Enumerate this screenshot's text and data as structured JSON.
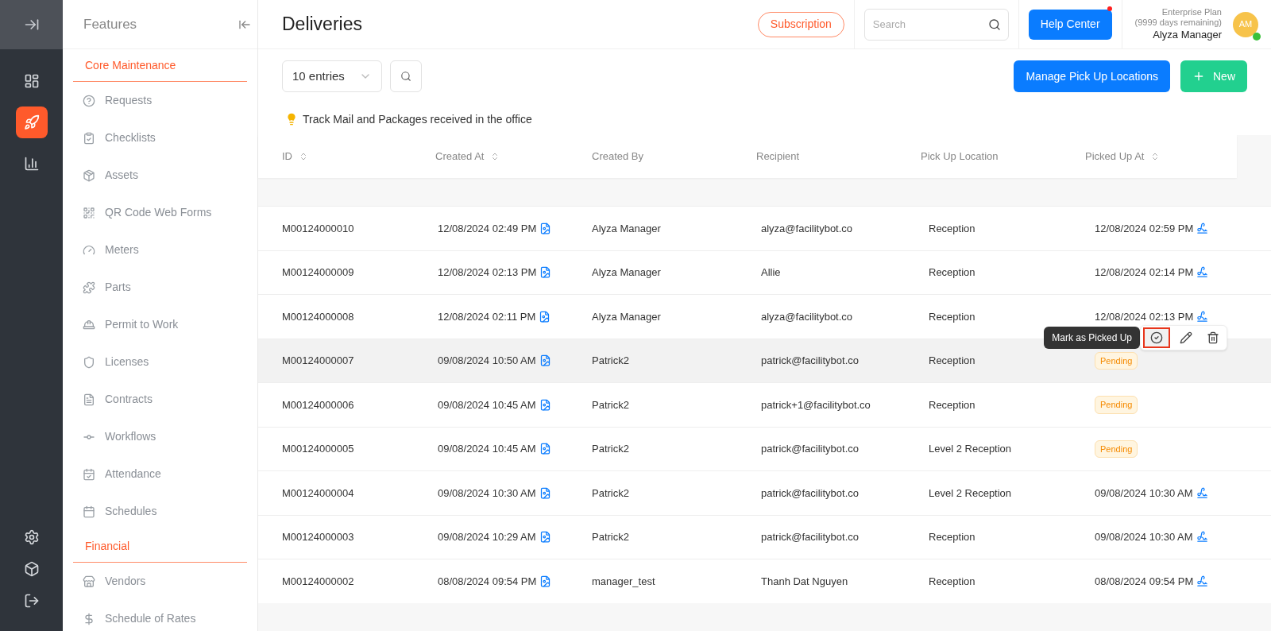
{
  "rail": {
    "items": [
      {
        "selected": false
      },
      {
        "selected": true
      },
      {
        "selected": false
      }
    ]
  },
  "features": {
    "title": "Features",
    "sections": [
      {
        "title": "Core Maintenance",
        "items": [
          {
            "label": "Requests"
          },
          {
            "label": "Checklists"
          },
          {
            "label": "Assets"
          },
          {
            "label": "QR Code Web Forms"
          },
          {
            "label": "Meters"
          },
          {
            "label": "Parts"
          },
          {
            "label": "Permit to Work"
          },
          {
            "label": "Licenses"
          },
          {
            "label": "Contracts"
          },
          {
            "label": "Workflows"
          },
          {
            "label": "Attendance"
          },
          {
            "label": "Schedules"
          }
        ]
      },
      {
        "title": "Financial",
        "items": [
          {
            "label": "Vendors"
          },
          {
            "label": "Schedule of Rates"
          }
        ]
      }
    ]
  },
  "header": {
    "title": "Deliveries",
    "subscription": "Subscription",
    "search": {
      "placeholder": "Search"
    },
    "help": "Help Center",
    "help_dot": true,
    "plan": "Enterprise Plan",
    "plan_days": "(9999 days remaining)",
    "user": "Alyza Manager",
    "avatar": "AM",
    "online": true
  },
  "toolbar": {
    "entries": "10 entries",
    "manage": "Manage Pick Up Locations",
    "new": "New"
  },
  "tip": "Track Mail and Packages received in the office",
  "table": {
    "columns": [
      {
        "label": "ID",
        "sortable": true
      },
      {
        "label": "Created At",
        "sortable": true
      },
      {
        "label": "Created By",
        "sortable": false
      },
      {
        "label": "Recipient",
        "sortable": false
      },
      {
        "label": "Pick Up Location",
        "sortable": false
      },
      {
        "label": "Picked Up At",
        "sortable": true
      }
    ],
    "rows": [
      {
        "id": "M00124000010",
        "created_at": "12/08/2024 02:49 PM",
        "created_by": "Alyza Manager",
        "recipient": "alyza@facilitybot.co",
        "location": "Reception",
        "kind": "picked",
        "picked_up": "12/08/2024 02:59 PM",
        "hovered": false
      },
      {
        "id": "M00124000009",
        "created_at": "12/08/2024 02:13 PM",
        "created_by": "Alyza Manager",
        "recipient": "Allie",
        "location": "Reception",
        "kind": "picked",
        "picked_up": "12/08/2024 02:14 PM",
        "hovered": false
      },
      {
        "id": "M00124000008",
        "created_at": "12/08/2024 02:11 PM",
        "created_by": "Alyza Manager",
        "recipient": "alyza@facilitybot.co",
        "location": "Reception",
        "kind": "picked",
        "picked_up": "12/08/2024 02:13 PM",
        "hovered": false
      },
      {
        "id": "M00124000007",
        "created_at": "09/08/2024 10:50 AM",
        "created_by": "Patrick2",
        "recipient": "patrick@facilitybot.co",
        "location": "Reception",
        "kind": "pending",
        "picked_up": "Pending",
        "hovered": true
      },
      {
        "id": "M00124000006",
        "created_at": "09/08/2024 10:45 AM",
        "created_by": "Patrick2",
        "recipient": "patrick+1@facilitybot.co",
        "location": "Reception",
        "kind": "pending",
        "picked_up": "Pending",
        "hovered": false
      },
      {
        "id": "M00124000005",
        "created_at": "09/08/2024 10:45 AM",
        "created_by": "Patrick2",
        "recipient": "patrick@facilitybot.co",
        "location": "Level 2 Reception",
        "kind": "pending",
        "picked_up": "Pending",
        "hovered": false
      },
      {
        "id": "M00124000004",
        "created_at": "09/08/2024 10:30 AM",
        "created_by": "Patrick2",
        "recipient": "patrick@facilitybot.co",
        "location": "Level 2 Reception",
        "kind": "picked",
        "picked_up": "09/08/2024 10:30 AM",
        "hovered": false
      },
      {
        "id": "M00124000003",
        "created_at": "09/08/2024 10:29 AM",
        "created_by": "Patrick2",
        "recipient": "patrick@facilitybot.co",
        "location": "Reception",
        "kind": "picked",
        "picked_up": "09/08/2024 10:30 AM",
        "hovered": false
      },
      {
        "id": "M00124000002",
        "created_at": "08/08/2024 09:54 PM",
        "created_by": "manager_test",
        "recipient": "Thanh Dat Nguyen",
        "location": "Reception",
        "kind": "picked",
        "picked_up": "08/08/2024 09:54 PM",
        "hovered": false
      }
    ],
    "tooltip": "Mark as Picked Up"
  }
}
